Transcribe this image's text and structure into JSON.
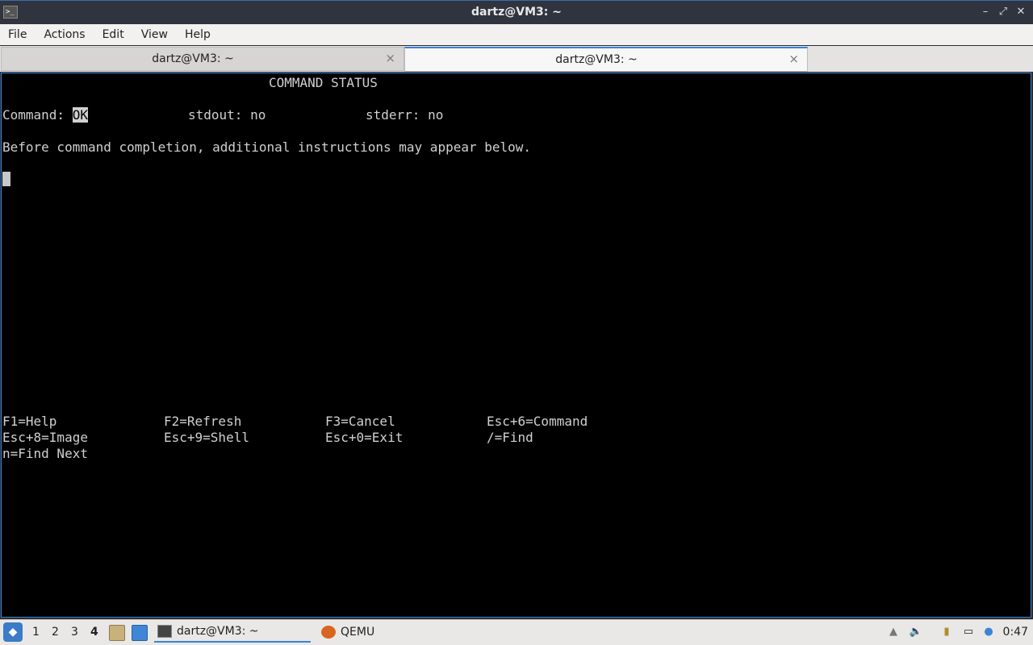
{
  "window": {
    "app_icon_glyph": ">_",
    "title": "dartz@VM3: ~",
    "controls": {
      "minimize": "–",
      "restore": "⤢",
      "close": "✕"
    }
  },
  "menu": [
    "File",
    "Actions",
    "Edit",
    "View",
    "Help"
  ],
  "tabs": [
    {
      "label": "dartz@VM3: ~",
      "close": "×",
      "active": false
    },
    {
      "label": "dartz@VM3: ~",
      "close": "×",
      "active": true
    }
  ],
  "terminal": {
    "header": "COMMAND STATUS",
    "command_label": "Command: ",
    "command_value": "OK",
    "stdout": "stdout: no",
    "stderr": "stderr: no",
    "note": "Before command completion, additional instructions may appear below.",
    "keys": [
      [
        "F1=Help",
        "F2=Refresh",
        "F3=Cancel",
        "Esc+6=Command"
      ],
      [
        "Esc+8=Image",
        "Esc+9=Shell",
        "Esc+0=Exit",
        "/=Find"
      ],
      [
        "n=Find Next"
      ]
    ]
  },
  "taskbar": {
    "start_icon": "start-menu-icon",
    "desktops": [
      "1",
      "2",
      "3",
      "4"
    ],
    "current_desktop": "4",
    "tasks": [
      {
        "label": "dartz@VM3: ~",
        "icon": "terminal-icon",
        "active": true
      },
      {
        "label": "QEMU",
        "icon": "qemu-icon",
        "active": false
      }
    ],
    "clock": "0:47"
  }
}
